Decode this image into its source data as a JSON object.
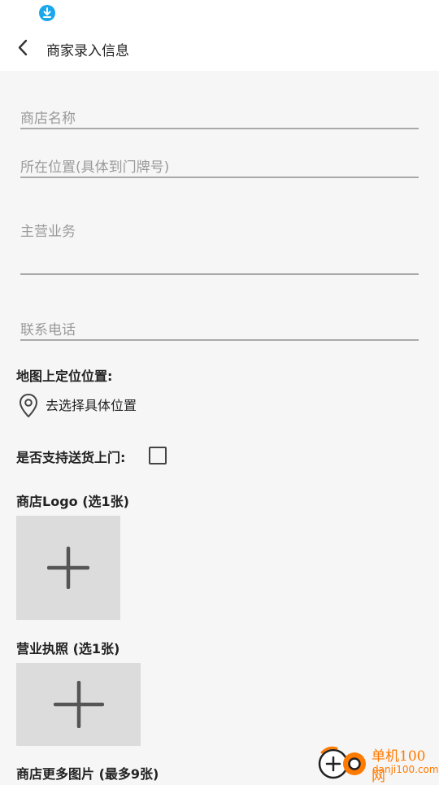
{
  "status_bar": {
    "icon": "download-icon",
    "icon_color": "#1aa7ec"
  },
  "app_bar": {
    "title": "商家录入信息",
    "back_icon": "chevron-left-icon"
  },
  "form": {
    "shop_name_placeholder": "商店名称",
    "address_placeholder": "所在位置(具体到门牌号)",
    "business_placeholder": "主营业务",
    "phone_placeholder": "联系电话",
    "map_label": "地图上定位位置:",
    "map_action": "去选择具体位置",
    "delivery_label": "是否支持送货上门:",
    "delivery_checked": false,
    "logo_label": "商店Logo (选1张)",
    "license_label": "营业执照 (选1张)",
    "more_photos_label": "商店更多图片 (最多9张)"
  },
  "watermark": {
    "name": "单机100网",
    "url": "danji100.com",
    "color": "#ff7a00"
  }
}
